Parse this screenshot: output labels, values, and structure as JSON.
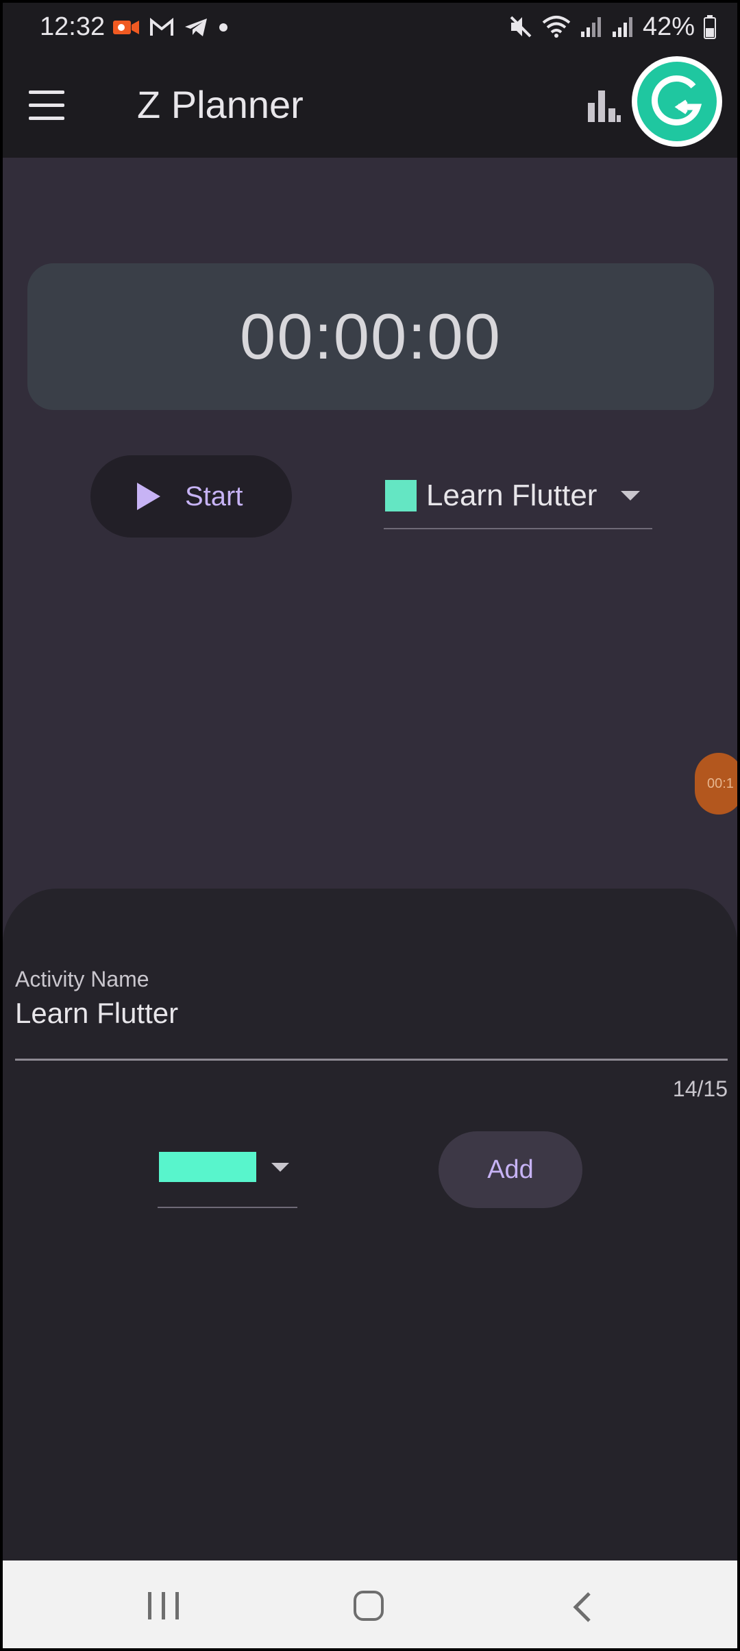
{
  "status_bar": {
    "time": "12:32",
    "left_icons": [
      "video-record-icon",
      "gmail-icon",
      "telegram-icon",
      "dot-icon"
    ],
    "right_icons": [
      "mute-icon",
      "wifi-icon",
      "signal-icon",
      "signal-icon",
      "battery-icon"
    ],
    "battery": "42%"
  },
  "app_bar": {
    "title": "Z Planner",
    "menu_icon": "menu-icon",
    "stats_icon": "bar-chart-icon",
    "avatar_icon": "grammarly-icon",
    "avatar_color": "#1fc7a0"
  },
  "timer": {
    "display": "00:00:00"
  },
  "controls": {
    "start_label": "Start",
    "start_icon": "play-icon",
    "accent_color": "#c7b3f5",
    "activity_select": {
      "selected": "Learn Flutter",
      "swatch_color": "#64e6c3"
    }
  },
  "bubble": {
    "text": "00:1"
  },
  "sheet": {
    "field_label": "Activity Name",
    "field_value": "Learn Flutter",
    "counter": "14/15",
    "color_select": {
      "swatch_color": "#58f5cc"
    },
    "add_label": "Add"
  },
  "nav_bar": {
    "recent_icon": "recent-apps-icon",
    "home_icon": "home-icon",
    "back_icon": "back-icon"
  }
}
